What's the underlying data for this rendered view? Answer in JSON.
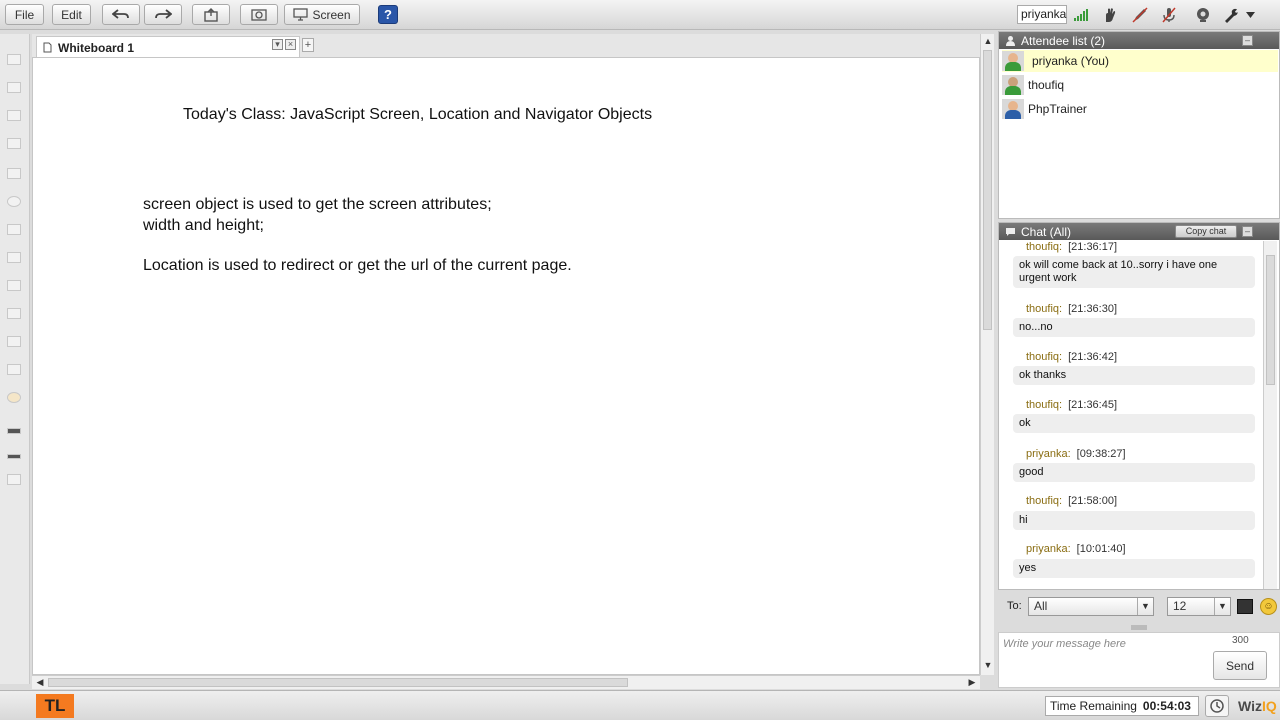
{
  "toolbar": {
    "file_label": "File",
    "edit_label": "Edit",
    "screen_label": "Screen",
    "help_label": "?",
    "user_label": "priyanka",
    "icons": [
      "undo-icon",
      "redo-icon",
      "import-icon",
      "record-icon",
      "screen-icon",
      "signal-icon",
      "hand-raise-icon",
      "pen-icon",
      "mic-icon",
      "webcam-icon",
      "wrench-icon"
    ]
  },
  "whiteboard": {
    "tab_label": "Whiteboard 1",
    "title": "Today's Class: JavaScript Screen, Location and Navigator Objects",
    "lines": [
      "screen object is used to get the screen attributes;",
      "width and height;",
      "Location is used to redirect or get the url of the current page."
    ]
  },
  "attendees": {
    "header": "Attendee list (2)",
    "items": [
      {
        "name": "priyanka (You)",
        "avatar_color": "#3a9b3a",
        "highlight": true
      },
      {
        "name": "thoufiq",
        "avatar_color": "#3a9b3a",
        "highlight": false
      },
      {
        "name": "PhpTrainer",
        "avatar_color": "#2d5fa8",
        "highlight": false
      }
    ]
  },
  "chat": {
    "header": "Chat (All)",
    "copy_label": "Copy chat",
    "messages": [
      {
        "sender": "thoufiq:",
        "time": "[21:36:17]",
        "text": "ok will come back at 10..sorry i have one urgent work"
      },
      {
        "sender": "thoufiq:",
        "time": "[21:36:30]",
        "text": "no...no"
      },
      {
        "sender": "thoufiq:",
        "time": "[21:36:42]",
        "text": "ok thanks"
      },
      {
        "sender": "thoufiq:",
        "time": "[21:36:45]",
        "text": "ok"
      },
      {
        "sender": "priyanka:",
        "time": "[09:38:27]",
        "text": "good"
      },
      {
        "sender": "thoufiq:",
        "time": "[21:58:00]",
        "text": "hi"
      },
      {
        "sender": "priyanka:",
        "time": "[10:01:40]",
        "text": "yes"
      }
    ],
    "to_label": "To:",
    "to_value": "All",
    "font_size_value": "12",
    "compose_placeholder": "Write your message here",
    "char_count": "300",
    "send_label": "Send"
  },
  "bottom": {
    "logo": "TL",
    "time_label": "Time Remaining",
    "time_value": "00:54:03",
    "brand_a": "Wiz",
    "brand_b": "IQ"
  },
  "colors": {
    "accent": "#2a56a8",
    "logo_orange": "#f47a20",
    "sender_color": "#8a6d12",
    "highlight_row": "#ffffcc"
  }
}
